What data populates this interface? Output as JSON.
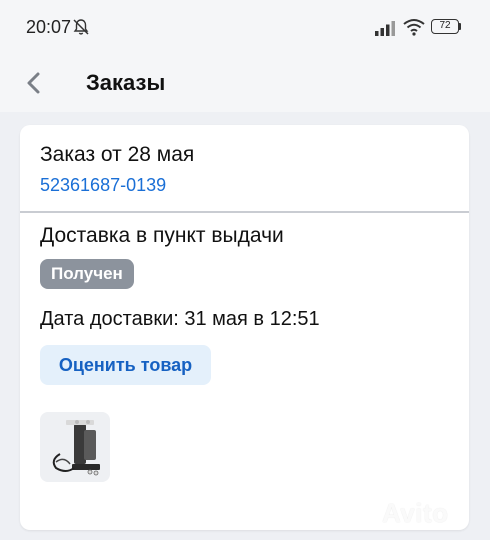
{
  "status_bar": {
    "time": "20:07",
    "battery": "72",
    "icons": [
      "bell-off-icon",
      "signal-icon",
      "wifi-icon",
      "battery-icon"
    ]
  },
  "header": {
    "title": "Заказы",
    "back_icon": "chevron-left-icon"
  },
  "order": {
    "title": "Заказ от 28 мая",
    "number": "52361687-0139",
    "delivery_type": "Доставка в пункт выдачи",
    "status": "Получен",
    "delivery_date": "Дата доставки: 31 мая в 12:51",
    "rate_button": "Оценить товар",
    "product_image": "product-thumbnail"
  },
  "watermark": "Avito",
  "colors": {
    "accent": "#1a6fd6",
    "button_bg": "#e4f0fb",
    "badge_bg": "#8c939d",
    "page_bg": "#eef0f4"
  }
}
